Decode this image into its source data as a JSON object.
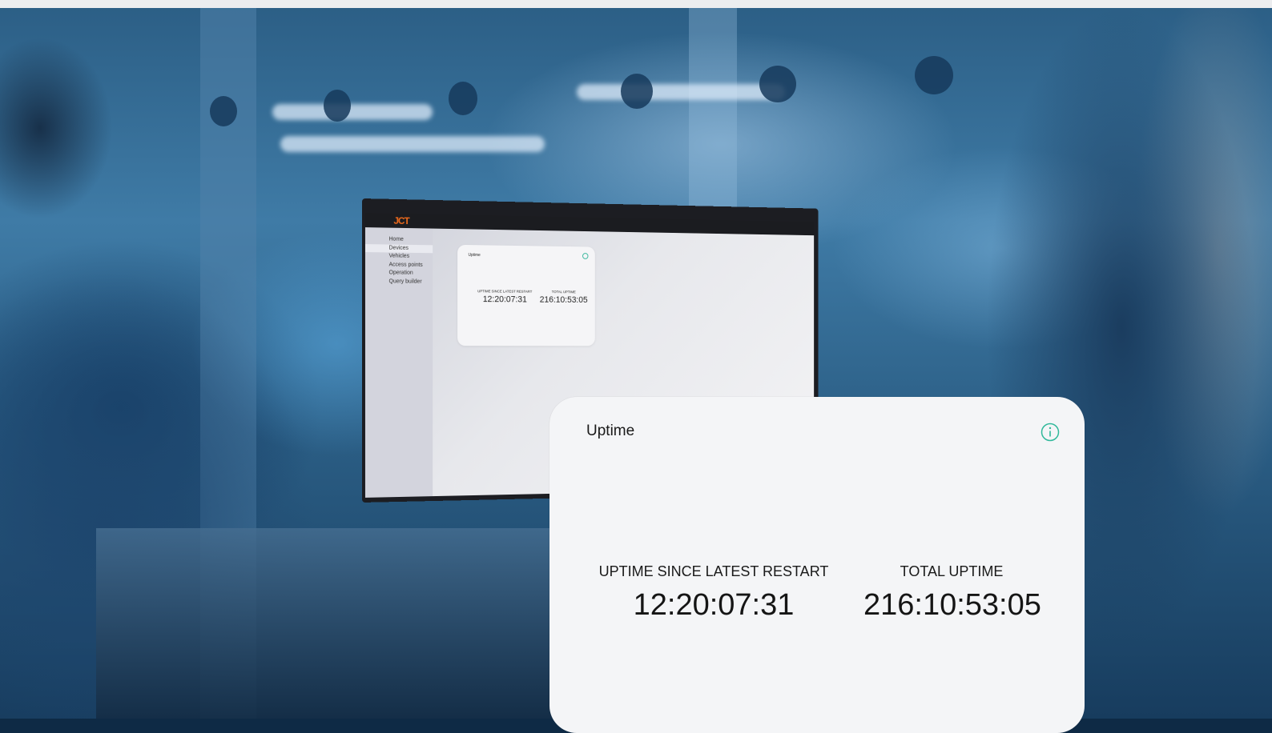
{
  "monitor": {
    "logo": "JCT",
    "nav": [
      "Home",
      "Devices",
      "Vehicles",
      "Access points",
      "Operation",
      "Query builder"
    ],
    "active_index": 1,
    "card": {
      "title": "Uptime",
      "since_restart_label": "UPTIME SINCE LATEST RESTART",
      "since_restart_value": "12:20:07:31",
      "total_label": "TOTAL UPTIME",
      "total_value": "216:10:53:05"
    }
  },
  "widget": {
    "title": "Uptime",
    "info_icon": "info-icon",
    "since_restart": {
      "label": "UPTIME SINCE LATEST RESTART",
      "value": "12:20:07:31"
    },
    "total": {
      "label": "TOTAL UPTIME",
      "value": "216:10:53:05"
    },
    "accent_color": "#2fb89a"
  }
}
